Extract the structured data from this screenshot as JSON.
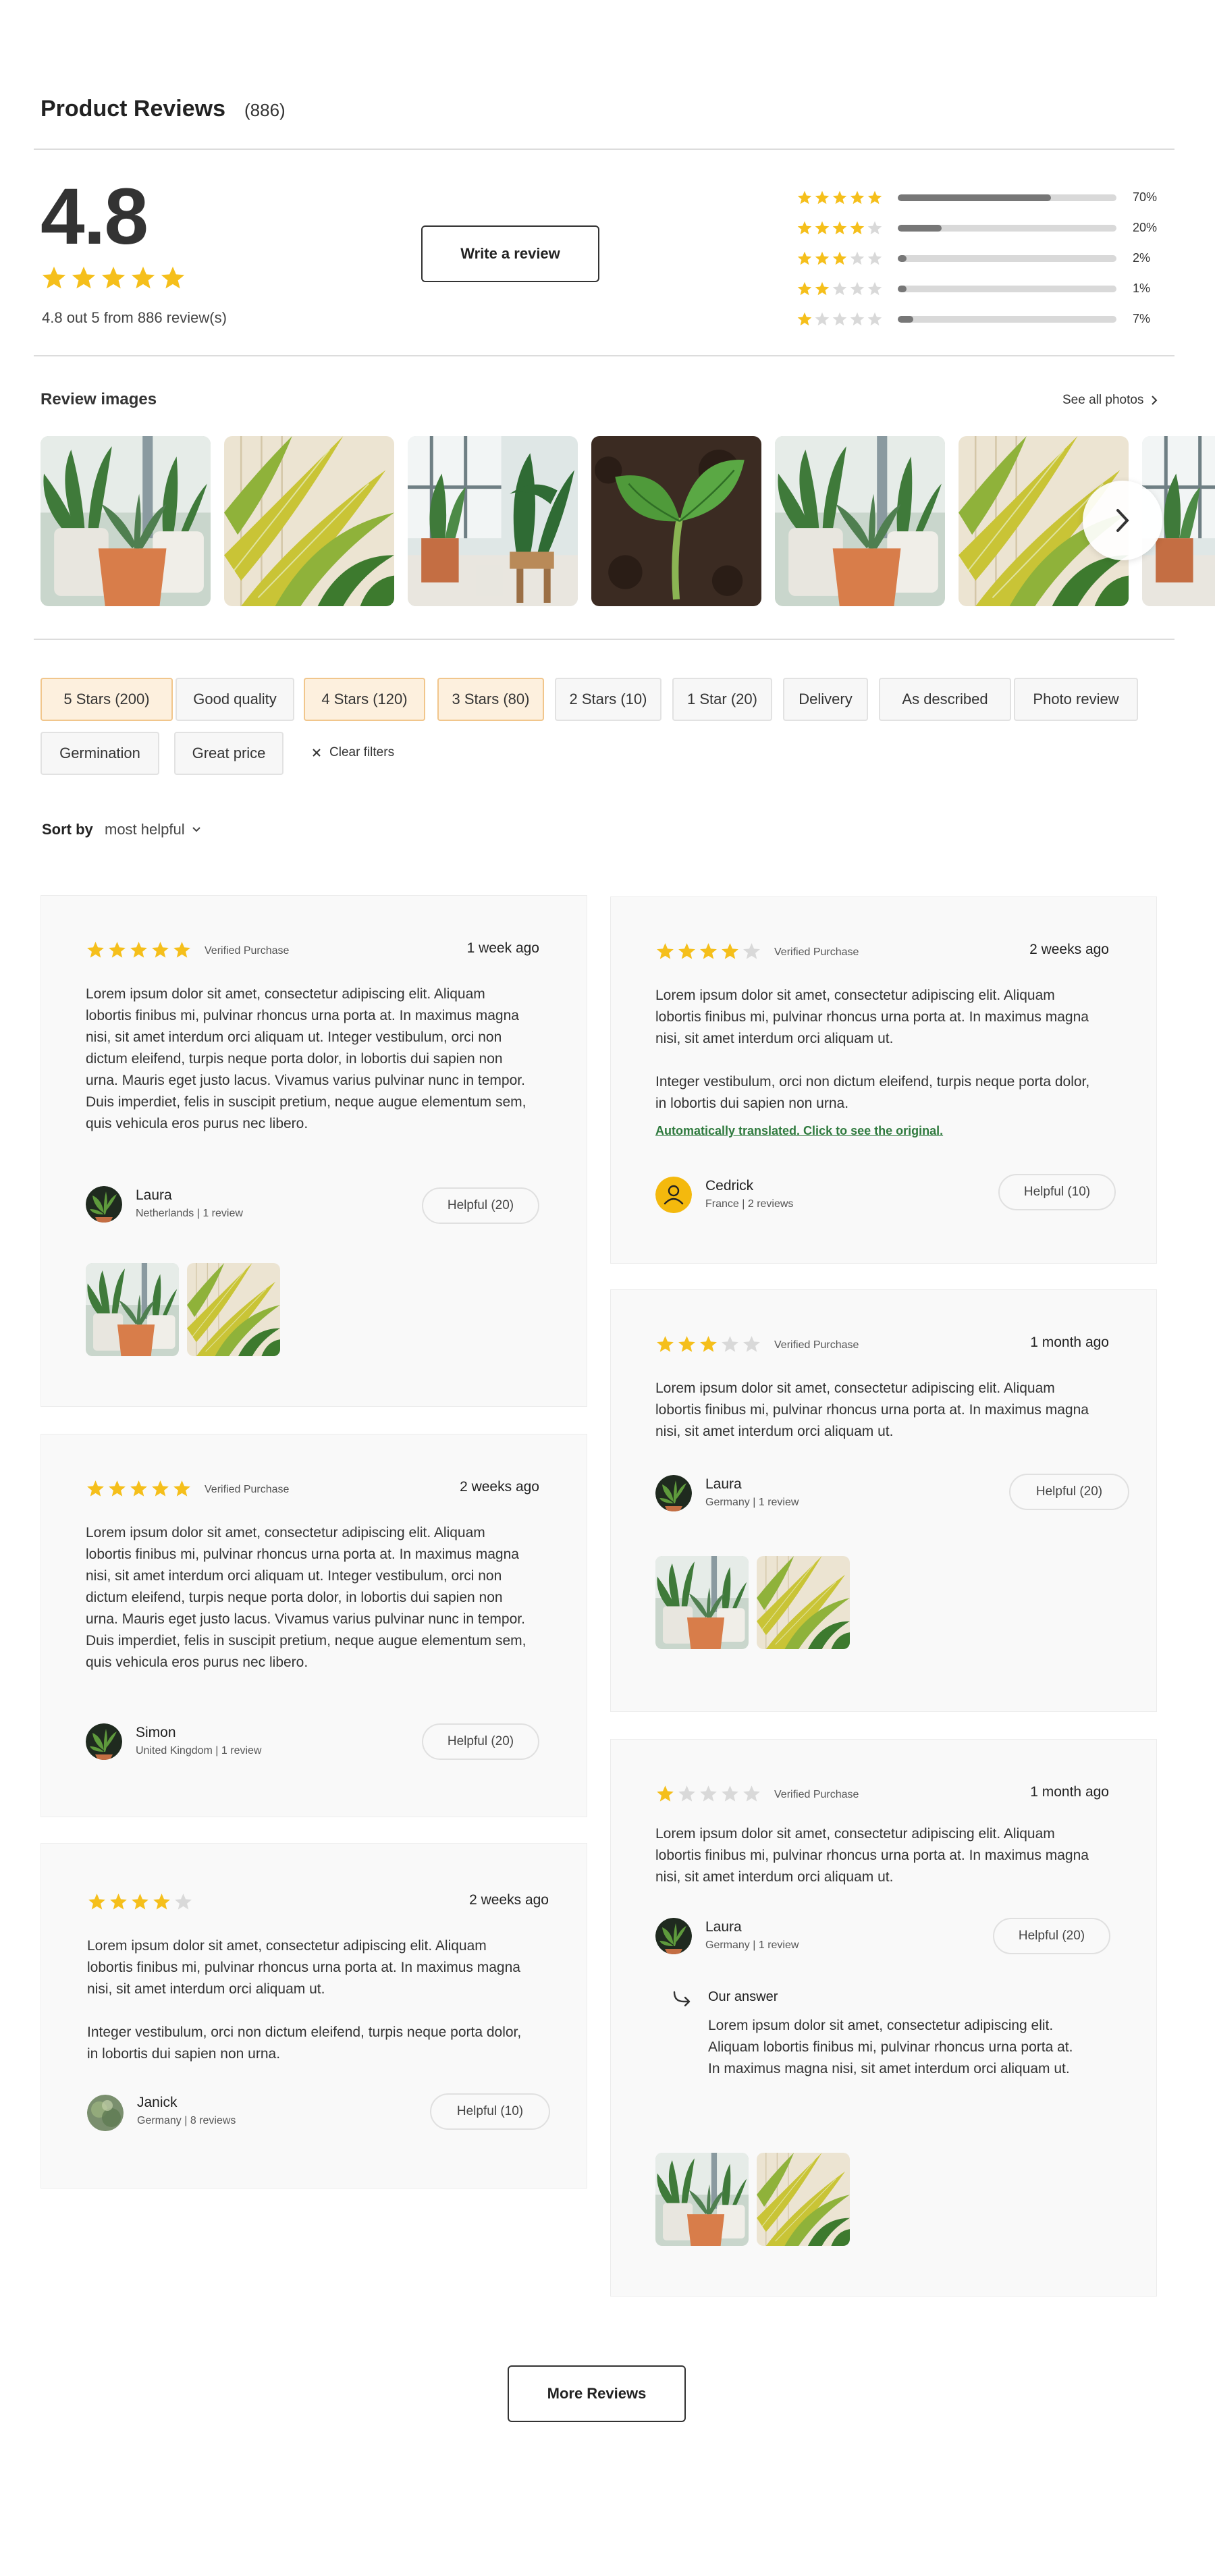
{
  "header": {
    "title": "Product Reviews",
    "count": "(886)"
  },
  "summary": {
    "average": "4.8",
    "average_stars": 5,
    "note": "4.8 out 5 from 886 review(s)",
    "write_label": "Write a review",
    "distribution": [
      {
        "stars": 5,
        "percent": 70,
        "label": "70%"
      },
      {
        "stars": 4,
        "percent": 20,
        "label": "20%"
      },
      {
        "stars": 3,
        "percent": 2,
        "label": "2%"
      },
      {
        "stars": 2,
        "percent": 1,
        "label": "1%"
      },
      {
        "stars": 1,
        "percent": 7,
        "label": "7%"
      }
    ]
  },
  "images": {
    "title": "Review images",
    "see_all": "See all photos"
  },
  "filters": {
    "chips": [
      {
        "label": "5 Stars (200)",
        "active": true
      },
      {
        "label": "Good quality",
        "active": false
      },
      {
        "label": "4 Stars (120)",
        "active": true
      },
      {
        "label": "3 Stars (80)",
        "active": true
      },
      {
        "label": "2 Stars (10)",
        "active": false
      },
      {
        "label": "1 Star (20)",
        "active": false
      },
      {
        "label": "Delivery",
        "active": false
      },
      {
        "label": "As described",
        "active": false
      },
      {
        "label": "Photo review",
        "active": false
      },
      {
        "label": "Germination",
        "active": false
      },
      {
        "label": "Great price",
        "active": false
      }
    ],
    "clear": "Clear filters"
  },
  "sort": {
    "label": "Sort by",
    "value": "most helpful"
  },
  "reviews": [
    {
      "rating": 5,
      "verified": "Verified Purchase",
      "date": "1 week ago",
      "paragraphs": [
        "Lorem ipsum dolor sit amet, consectetur adipiscing elit. Aliquam lobortis finibus mi, pulvinar rhoncus urna porta at. In maximus magna nisi, sit amet interdum orci aliquam ut. Integer vestibulum, orci non dictum eleifend, turpis neque porta dolor, in lobortis dui sapien non urna. Mauris eget justo lacus. Vivamus varius pulvinar nunc in tempor. Duis imperdiet, felis in suscipit pretium, neque augue elementum sem, quis vehicula eros purus nec libero."
      ],
      "name": "Laura",
      "meta": "Netherlands | 1 review",
      "helpful": "Helpful (20)"
    },
    {
      "rating": 4,
      "verified": "Verified Purchase",
      "date": "2 weeks ago",
      "paragraphs": [
        "Lorem ipsum dolor sit amet, consectetur adipiscing elit. Aliquam lobortis finibus mi, pulvinar rhoncus urna porta at. In maximus magna nisi, sit amet interdum orci aliquam ut.",
        "Integer vestibulum, orci non dictum eleifend, turpis neque porta dolor, in lobortis dui sapien non urna."
      ],
      "translate": "Automatically translated. Click to see the original.",
      "name": "Cedrick",
      "meta": "France | 2 reviews",
      "helpful": "Helpful (10)"
    },
    {
      "rating": 3,
      "verified": "Verified Purchase",
      "date": "1 month ago",
      "paragraphs": [
        "Lorem ipsum dolor sit amet, consectetur adipiscing elit. Aliquam lobortis finibus mi, pulvinar rhoncus urna porta at. In maximus magna nisi, sit amet interdum orci aliquam ut."
      ],
      "name": "Laura",
      "meta": "Germany | 1 review",
      "helpful": "Helpful (20)"
    },
    {
      "rating": 5,
      "verified": "Verified Purchase",
      "date": "2 weeks ago",
      "paragraphs": [
        "Lorem ipsum dolor sit amet, consectetur adipiscing elit. Aliquam lobortis finibus mi, pulvinar rhoncus urna porta at. In maximus magna nisi, sit amet interdum orci aliquam ut. Integer vestibulum, orci non dictum eleifend, turpis neque porta dolor, in lobortis dui sapien non urna. Mauris eget justo lacus. Vivamus varius pulvinar nunc in tempor. Duis imperdiet, felis in suscipit pretium, neque augue elementum sem, quis vehicula eros purus nec libero."
      ],
      "name": "Simon",
      "meta": "United Kingdom | 1 review",
      "helpful": "Helpful (20)"
    },
    {
      "rating": 1,
      "verified": "Verified Purchase",
      "date": "1 month ago",
      "paragraphs": [
        "Lorem ipsum dolor sit amet, consectetur adipiscing elit. Aliquam lobortis finibus mi, pulvinar rhoncus urna porta at. In maximus magna nisi, sit amet interdum orci aliquam ut."
      ],
      "name": "Laura",
      "meta": "Germany | 1 review",
      "helpful": "Helpful (20)",
      "answer_title": "Our answer",
      "answer_text": "Lorem ipsum dolor sit amet, consectetur adipiscing elit. Aliquam lobortis finibus mi, pulvinar rhoncus urna porta at. In maximus magna nisi, sit amet interdum orci aliquam ut."
    },
    {
      "rating": 4,
      "date": "2 weeks ago",
      "paragraphs": [
        "Lorem ipsum dolor sit amet, consectetur adipiscing elit. Aliquam lobortis finibus mi, pulvinar rhoncus urna porta at. In maximus magna nisi, sit amet interdum orci aliquam ut.",
        "Integer vestibulum, orci non dictum eleifend, turpis neque porta dolor, in lobortis dui sapien non urna."
      ],
      "name": "Janick",
      "meta": "Germany | 8 reviews",
      "helpful": "Helpful (10)"
    }
  ],
  "more_label": "More Reviews",
  "colors": {
    "star_filled": "#f5bf1b",
    "star_empty": "#d9d9d9",
    "active_chip": "#fdf0de",
    "bar_fill": "#777777",
    "link_green": "#2f7a3e"
  }
}
